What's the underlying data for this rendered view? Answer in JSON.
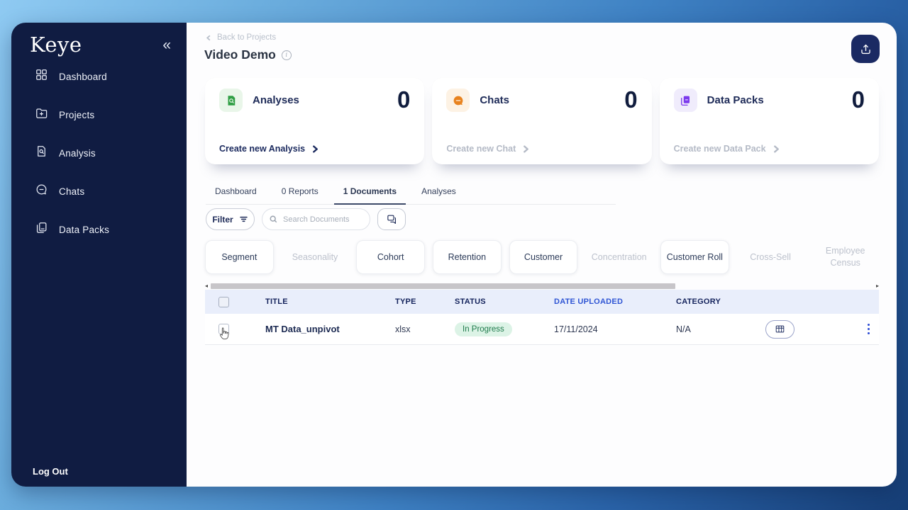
{
  "colors": {
    "sidebar_navy": "#101c42",
    "accent_navy": "#1b2a63",
    "date_header_blue": "#2f55d4",
    "status_in_progress_bg": "#dcf3e6",
    "status_in_progress_text": "#1e7a4b",
    "analyses_green": "#2f9e44",
    "chats_orange": "#e8821e",
    "datapacks_purple": "#7c3aed"
  },
  "sidebar": {
    "logo": "Keye",
    "collapse_icon": "«",
    "items": [
      {
        "label": "Dashboard"
      },
      {
        "label": "Projects"
      },
      {
        "label": "Analysis"
      },
      {
        "label": "Chats"
      },
      {
        "label": "Data Packs"
      }
    ],
    "logout_label": "Log Out"
  },
  "header": {
    "back_label": "Back to Projects",
    "title": "Video Demo"
  },
  "summary_cards": [
    {
      "title": "Analyses",
      "count": "0",
      "cta": "Create new Analysis"
    },
    {
      "title": "Chats",
      "count": "0",
      "cta": "Create new Chat"
    },
    {
      "title": "Data Packs",
      "count": "0",
      "cta": "Create new Data Pack"
    }
  ],
  "tabs": [
    {
      "label": "Dashboard"
    },
    {
      "label": "0 Reports"
    },
    {
      "label": "1 Documents"
    },
    {
      "label": "Analyses"
    }
  ],
  "toolbar": {
    "filter_label": "Filter",
    "search_placeholder": "Search Documents"
  },
  "category_chips": [
    {
      "label": "Segment"
    },
    {
      "label": "Seasonality"
    },
    {
      "label": "Cohort"
    },
    {
      "label": "Retention"
    },
    {
      "label": "Customer"
    },
    {
      "label": "Concentration"
    },
    {
      "label": "Customer Roll"
    },
    {
      "label": "Cross-Sell"
    },
    {
      "label": "Employee Census"
    }
  ],
  "table": {
    "columns": {
      "title": "TITLE",
      "type": "TYPE",
      "status": "STATUS",
      "date_uploaded": "DATE UPLOADED",
      "category": "CATEGORY"
    },
    "rows": [
      {
        "title": "MT Data_unpivot",
        "type": "xlsx",
        "status": "In Progress",
        "date_uploaded": "17/11/2024",
        "category": "N/A"
      }
    ]
  }
}
